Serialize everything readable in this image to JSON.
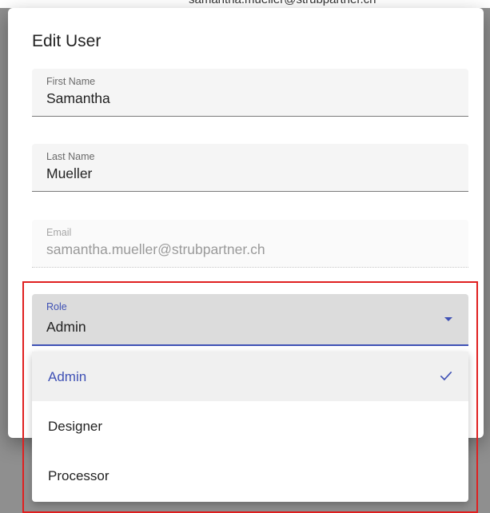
{
  "backdrop": {
    "cut_text": "samantha.mueller@strubpartner.ch"
  },
  "dialog": {
    "title": "Edit User",
    "fields": {
      "first_name": {
        "label": "First Name",
        "value": "Samantha"
      },
      "last_name": {
        "label": "Last Name",
        "value": "Mueller"
      },
      "email": {
        "label": "Email",
        "value": "samantha.mueller@strubpartner.ch",
        "disabled": true
      },
      "role": {
        "label": "Role",
        "value": "Admin",
        "icon": "caret-down-icon"
      }
    },
    "role_options": [
      {
        "label": "Admin",
        "selected": true,
        "icon": "check-icon"
      },
      {
        "label": "Designer",
        "selected": false
      },
      {
        "label": "Processor",
        "selected": false
      }
    ]
  },
  "colors": {
    "accent": "#3f51b5",
    "highlight": "#e02020",
    "backdrop": "#8f8f8f"
  }
}
